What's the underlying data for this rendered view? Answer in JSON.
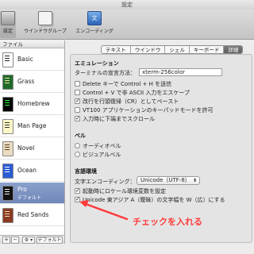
{
  "window": {
    "title": "設定"
  },
  "toolbar": {
    "items": [
      {
        "label": "設定"
      },
      {
        "label": "ウインドウグループ"
      },
      {
        "label": "エンコーディング"
      }
    ]
  },
  "sidebar": {
    "header": "ファイル",
    "profiles": [
      {
        "name": "Basic",
        "bg": "#ffffff",
        "fg": "#222222"
      },
      {
        "name": "Grass",
        "bg": "#1f6b2a",
        "fg": "#f3e6a0"
      },
      {
        "name": "Homebrew",
        "bg": "#000000",
        "fg": "#27ff3a"
      },
      {
        "name": "Man Page",
        "bg": "#fdf7c8",
        "fg": "#333333"
      },
      {
        "name": "Novel",
        "bg": "#e9dcc0",
        "fg": "#5a3a1a"
      },
      {
        "name": "Ocean",
        "bg": "#2b5bd6",
        "fg": "#ffffff"
      },
      {
        "name": "Pro",
        "sub": "デフォルト",
        "bg": "#111111",
        "fg": "#f2f2f2"
      },
      {
        "name": "Red Sands",
        "bg": "#8a3a22",
        "fg": "#f2dcb8"
      }
    ],
    "footer": {
      "add": "+",
      "remove": "−",
      "gear": "⚙ ▾",
      "default": "デフォルト"
    }
  },
  "tabs": [
    "テキスト",
    "ウインドウ",
    "シェル",
    "キーボード",
    "詳細"
  ],
  "emulation": {
    "title": "エミュレーション",
    "terminal_type_label": "ターミナルの宣言方法：",
    "terminal_type_value": "xterm-256color",
    "options": [
      {
        "label": "Delete キーで Control + H を送信",
        "checked": false
      },
      {
        "label": "Control + V で非 ASCII 入力をエスケープ",
        "checked": false
      },
      {
        "label": "改行を行頭復帰（CR）としてペースト",
        "checked": true
      },
      {
        "label": "VT100 アプリケーションのキーパッドモードを許可",
        "checked": false
      },
      {
        "label": "入力時に下端までスクロール",
        "checked": true
      }
    ]
  },
  "bell": {
    "title": "ベル",
    "options": [
      {
        "label": "オーディオベル"
      },
      {
        "label": "ビジュアルベル"
      }
    ]
  },
  "language": {
    "title": "言語環境",
    "encoding_label": "文字エンコーディング：",
    "encoding_value": "Unicode（UTF-8）",
    "options": [
      {
        "label": "起動時にロケール環境変数を設定",
        "checked": true
      },
      {
        "label": "Unicode 東アジア A（曖昧）の文字幅を W（広）にする",
        "checked": true
      }
    ]
  },
  "annotation": {
    "text": "チェックを入れる",
    "color": "#ff3a3a"
  }
}
